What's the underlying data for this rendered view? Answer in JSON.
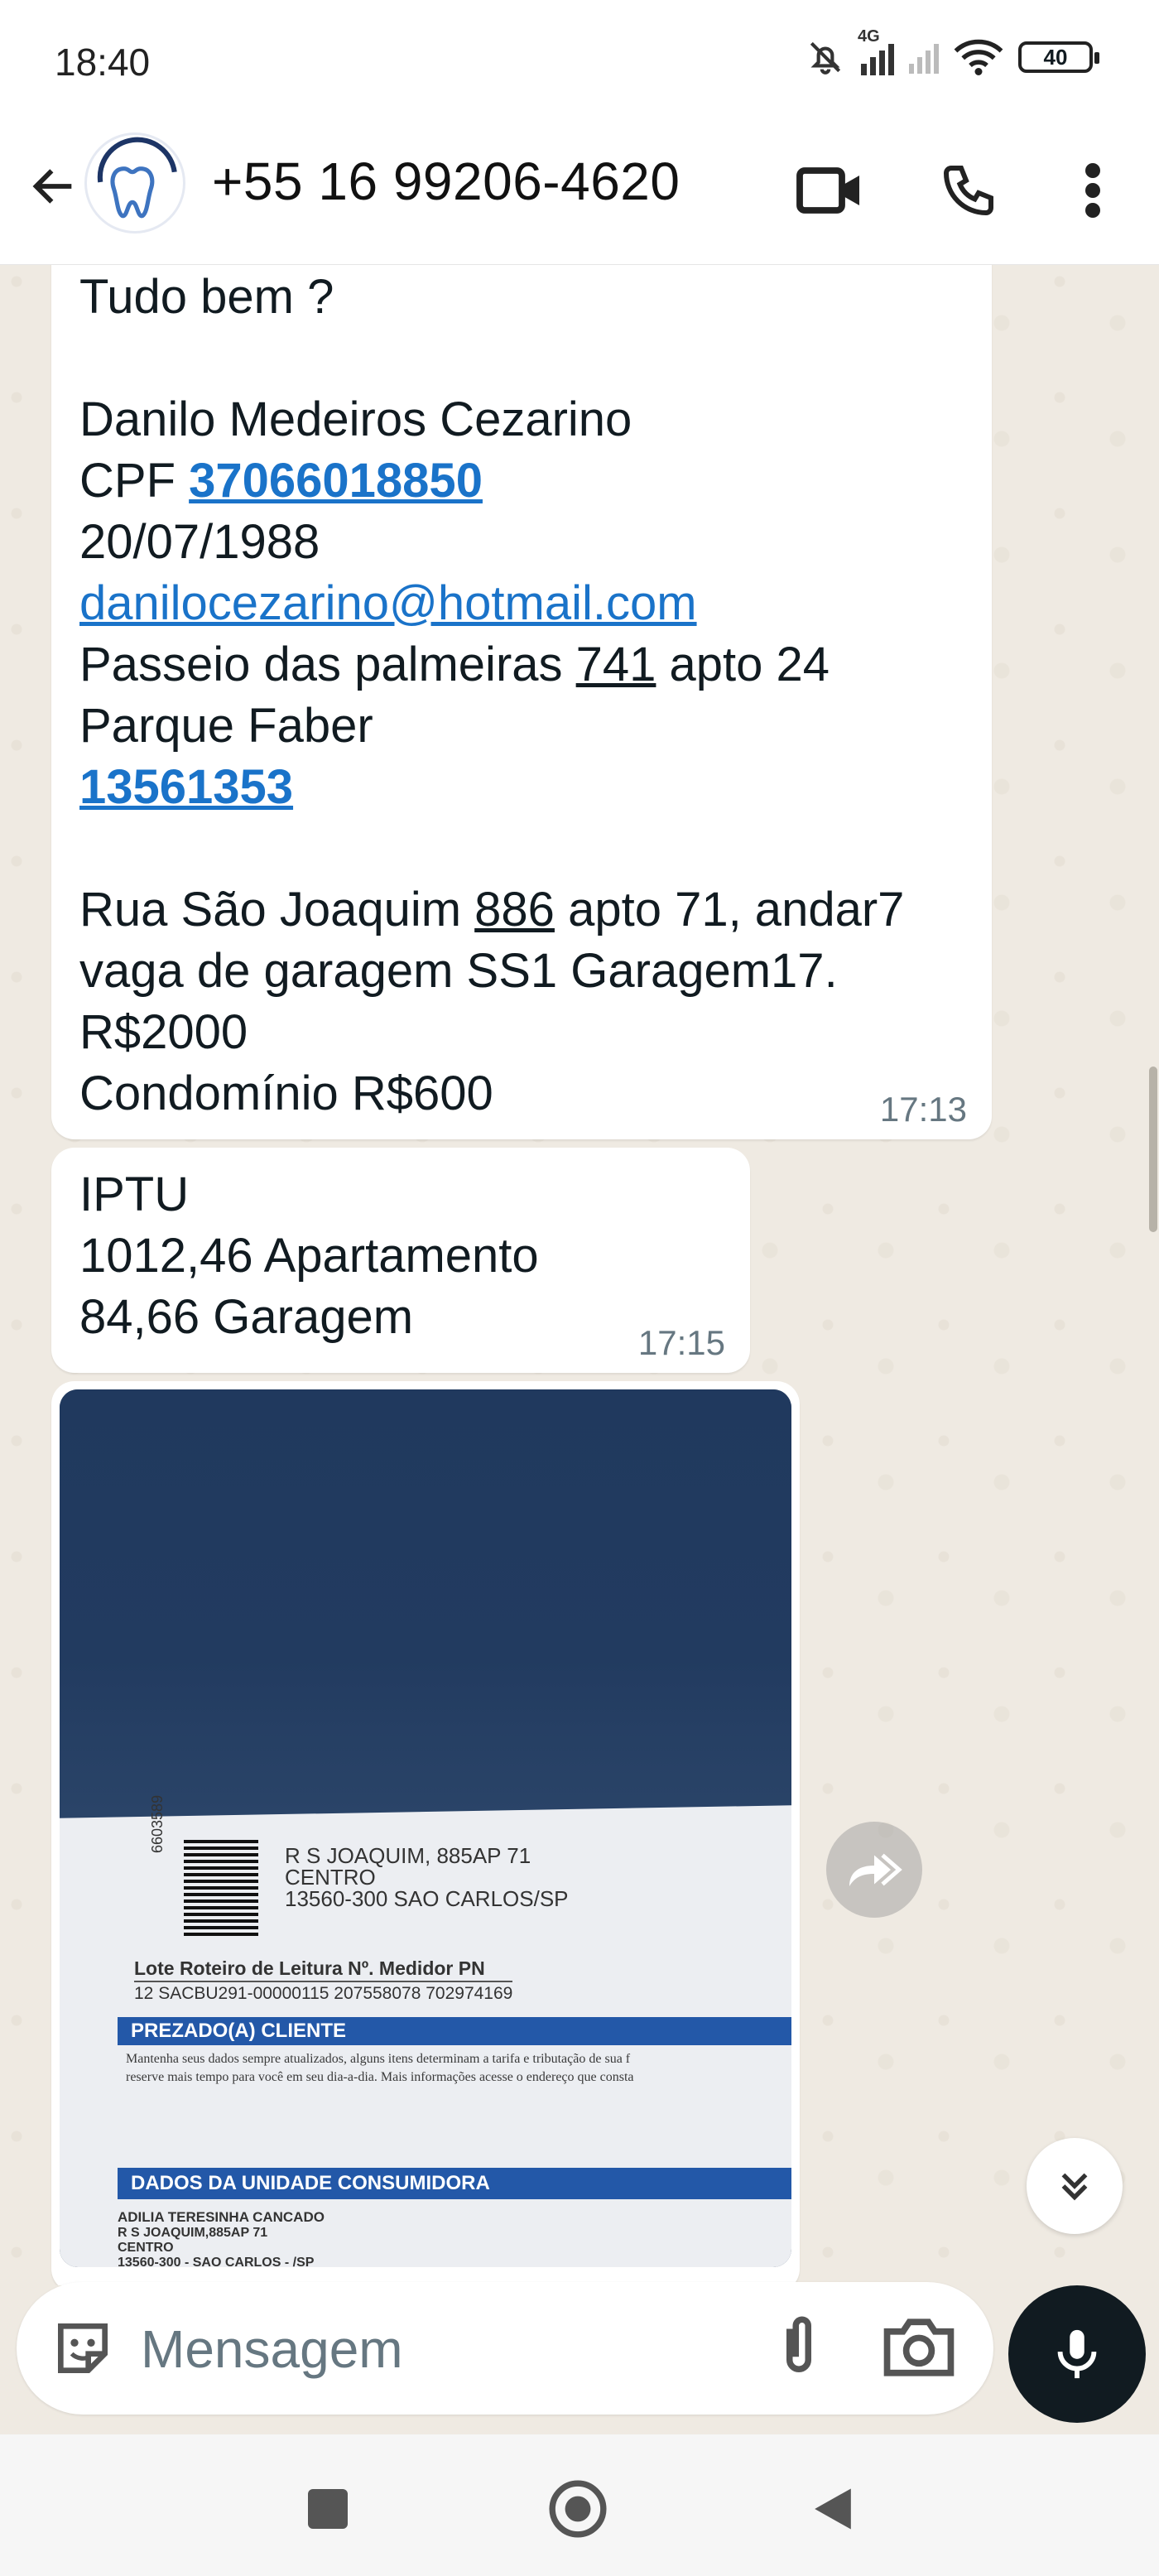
{
  "status": {
    "time": "18:40",
    "network": "4G",
    "battery": "40"
  },
  "header": {
    "contact": "+55 16 99206-4620"
  },
  "messages": {
    "m1": {
      "lines": {
        "greeting": "Tudo bem ?",
        "name": "Danilo Medeiros Cezarino",
        "cpf_label": "CPF ",
        "cpf": "37066018850",
        "birth": "20/07/1988",
        "email": "danilocezarino@hotmail.com",
        "addr1_a": "Passeio das palmeiras ",
        "addr1_num": "741",
        "addr1_b": " apto 24",
        "addr2": "Parque Faber",
        "cep": "13561353",
        "street_a": "Rua São Joaquim ",
        "street_num": "886",
        "street_b": " apto 71, andar7",
        "parking": "vaga de garagem SS1 Garagem17.",
        "rent": "R$2000",
        "condo": "Condomínio R$600"
      },
      "time": "17:13"
    },
    "m2": {
      "lines": {
        "title": "IPTU",
        "apt": "1012,46 Apartamento",
        "garage": "84,66 Garagem"
      },
      "time": "17:15"
    },
    "photo": {
      "addr1": "R S JOAQUIM, 885AP 71",
      "addr2": "CENTRO",
      "addr3": "13560-300 SAO CARLOS/SP",
      "barcode_num": "6603589",
      "table_header": "Lote  Roteiro de Leitura          Nº. Medidor      PN",
      "table_row": "12     SACBU291-00000115          207558078       702974169",
      "band1": "PREZADO(A) CLIENTE",
      "notice1": "Mantenha seus dados sempre atualizados, alguns itens determinam a tarifa e tributação de sua f",
      "notice2": "reserve mais tempo para você em seu dia-a-dia. Mais informações acesse o endereço que consta",
      "band2": "DADOS DA UNIDADE CONSUMIDORA",
      "unit1": "ADILIA TERESINHA CANCADO",
      "unit2": "R S JOAQUIM,885AP 71",
      "unit3": "CENTRO",
      "unit4": "13560-300 - SAO CARLOS - /SP"
    }
  },
  "input": {
    "placeholder": "Mensagem"
  },
  "colors": {
    "link": "#1a73c9",
    "chat_bg": "#efeae2",
    "mic_bg": "#111b21"
  }
}
